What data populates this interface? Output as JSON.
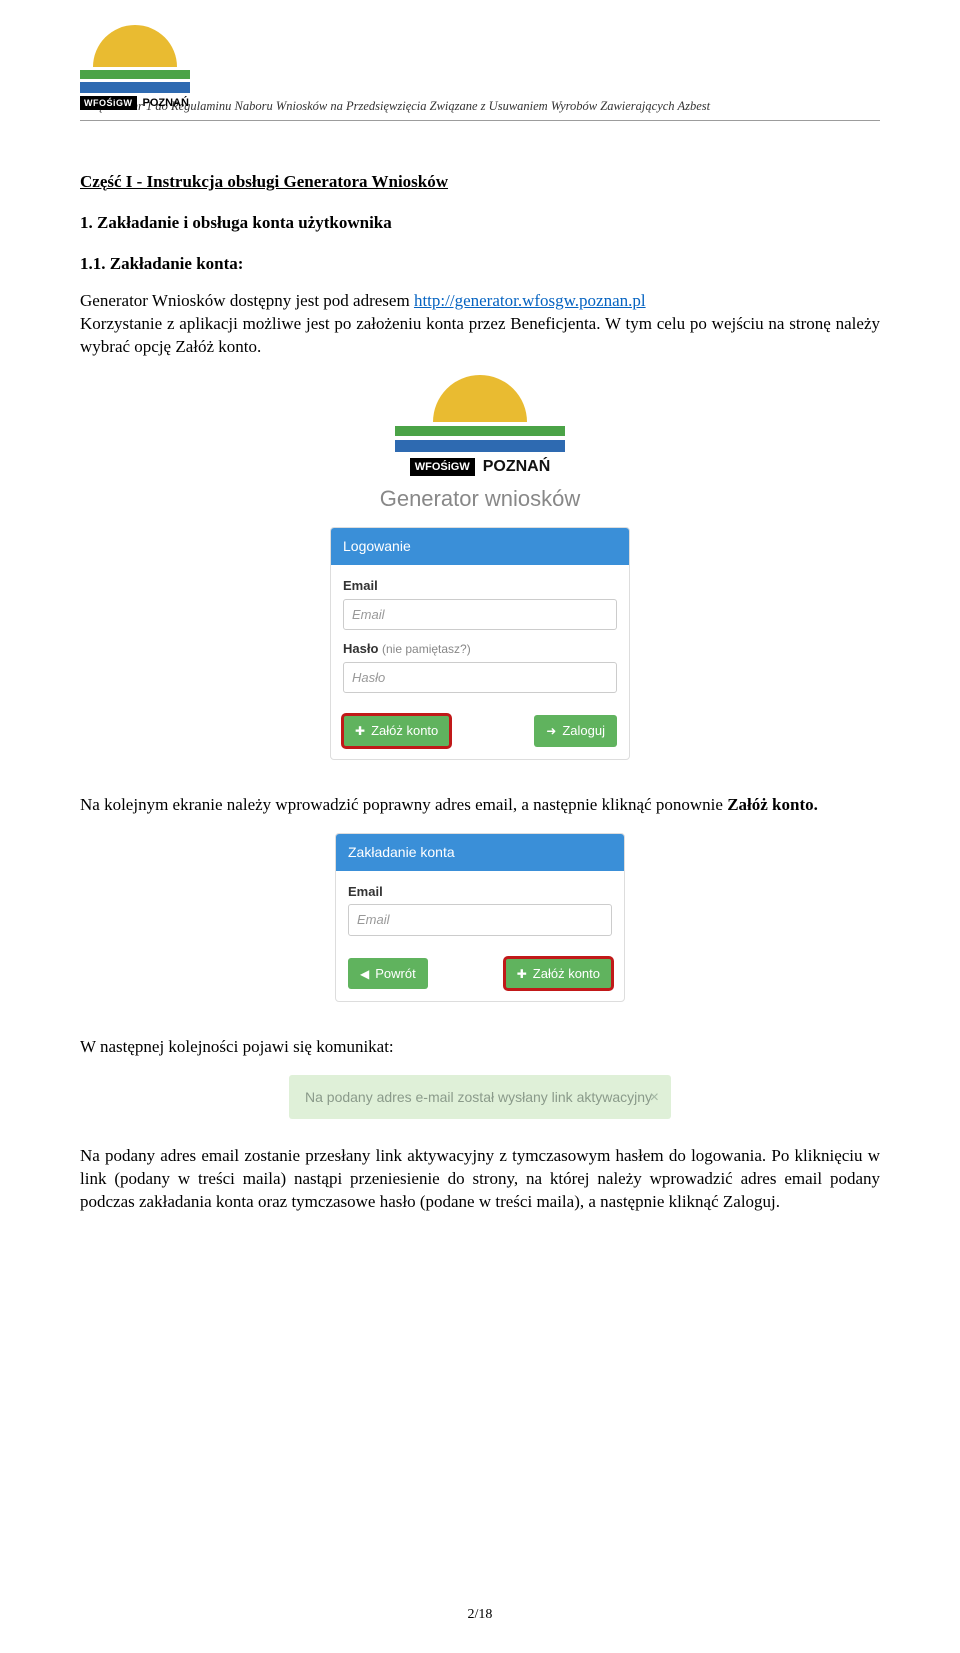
{
  "header": {
    "logo_text": "WFOŚiGW",
    "logo_city": "POZNAŃ",
    "header_line": "Załącznik nr 1 do Regulaminu Naboru  Wniosków na Przedsięwzięcia Związane z Usuwaniem Wyrobów Zawierających Azbest"
  },
  "section": {
    "title": "Część I  -  Instrukcja obsługi Generatora Wniosków",
    "h2": "1.   Zakładanie i obsługa konta użytkownika",
    "h3": "1.1. Zakładanie konta:",
    "p1a": "Generator Wniosków dostępny jest pod adresem ",
    "p1_link": "http://generator.wfosgw.poznan.pl",
    "p2": "Korzystanie z aplikacji możliwe jest po założeniu konta przez Beneficjenta. W tym celu po wejściu na stronę należy wybrać opcję Załóż konto.",
    "p3a": "Na kolejnym ekranie należy wprowadzić poprawny adres email, a następnie kliknąć ponownie ",
    "p3b": "Załóż konto.",
    "p4": "W następnej kolejności pojawi się komunikat:",
    "p5": "Na podany adres email zostanie przesłany link aktywacyjny z tymczasowym hasłem do logowania. Po kliknięciu w link (podany w treści maila) nastąpi przeniesienie do strony, na której należy wprowadzić adres email podany podczas zakładania konta oraz tymczasowe hasło (podane w treści maila), a następnie kliknąć Zaloguj."
  },
  "ss1": {
    "app_title": "Generator wniosków",
    "panel_title": "Logowanie",
    "email_label": "Email",
    "email_placeholder": "Email",
    "password_label": "Hasło ",
    "password_hint": "(nie pamiętasz?)",
    "password_placeholder": "Hasło",
    "btn_create": "Załóż konto",
    "btn_login": "Zaloguj"
  },
  "ss2": {
    "panel_title": "Zakładanie konta",
    "email_label": "Email",
    "email_placeholder": "Email",
    "btn_back": "Powrót",
    "btn_create": "Załóż konto"
  },
  "alert": {
    "text": "Na podany adres e-mail został wysłany link aktywacyjny"
  },
  "footer": {
    "page": "2/18"
  }
}
